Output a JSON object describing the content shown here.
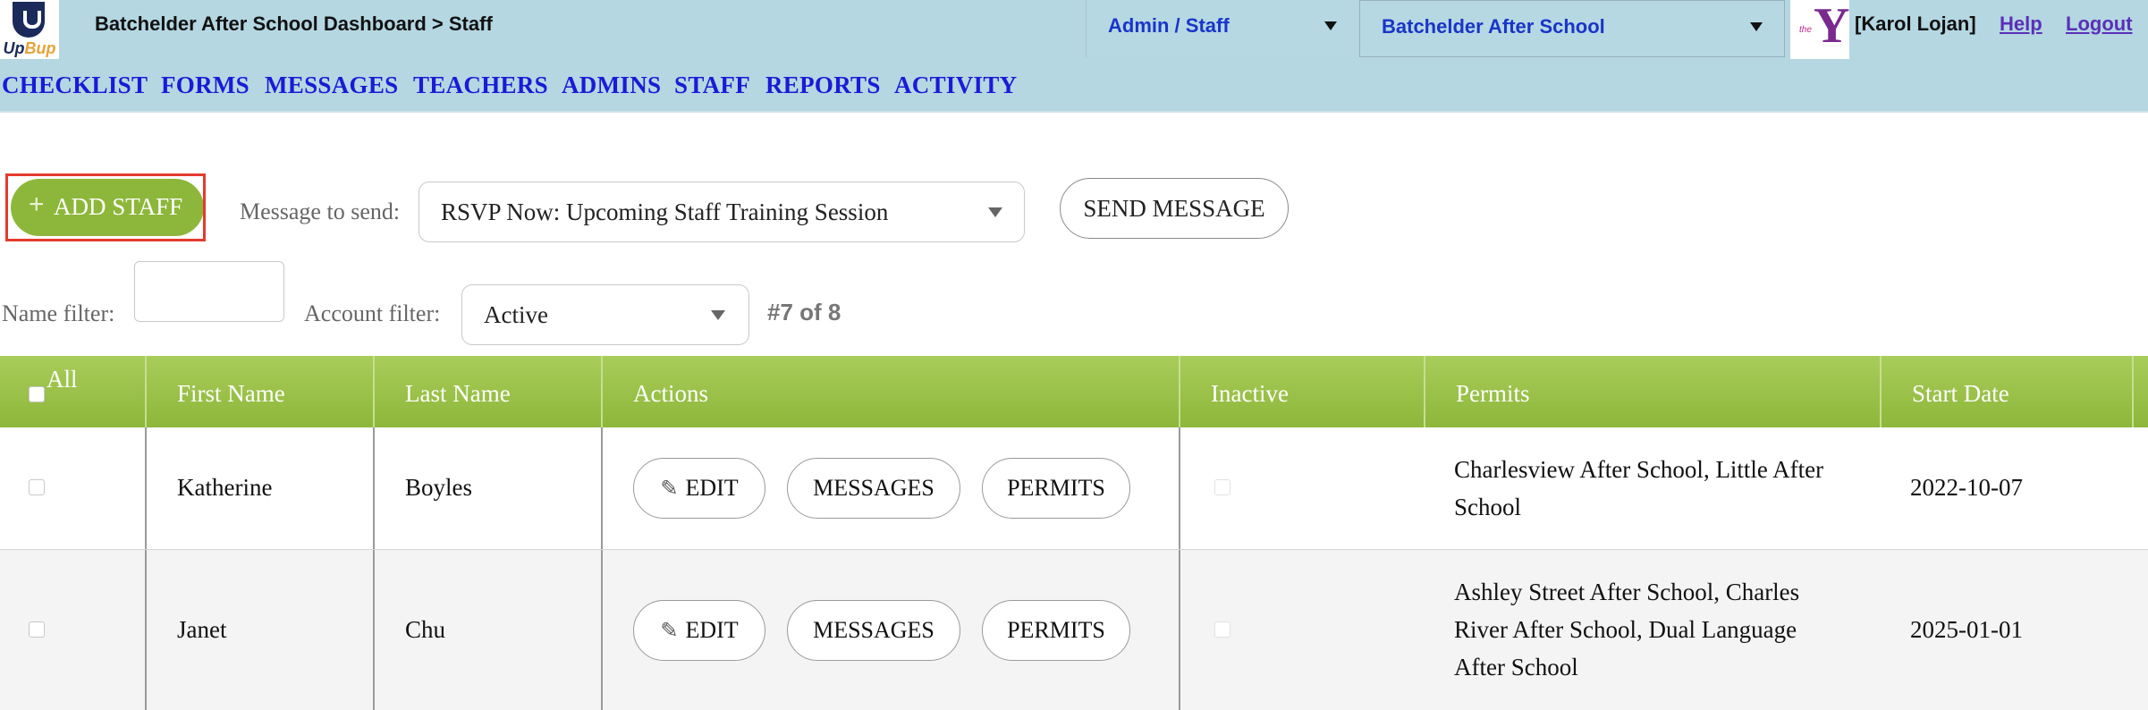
{
  "header": {
    "logo_text_main": "Up",
    "logo_text_accent": "Bup",
    "breadcrumb": "Batchelder After School Dashboard > Staff",
    "role_select": "Admin / Staff",
    "school_select": "Batchelder After School",
    "partner_logo_small": "the",
    "partner_logo_letter": "Y",
    "user": "[Karol Lojan]",
    "help": "Help",
    "logout": "Logout"
  },
  "nav": [
    "CHECKLIST",
    "FORMS",
    "MESSAGES",
    "TEACHERS",
    "ADMINS",
    "STAFF",
    "REPORTS",
    "ACTIVITY"
  ],
  "toolbar": {
    "add_plus": "+",
    "add_staff": "ADD STAFF",
    "message_label": "Message to send:",
    "message_selected": "RSVP Now: Upcoming Staff Training Session",
    "send_message": "SEND MESSAGE"
  },
  "filters": {
    "name_label": "Name filter:",
    "name_value": "",
    "account_label": "Account filter:",
    "account_selected": "Active",
    "counter": "#7 of 8"
  },
  "table": {
    "headers": {
      "all": "All",
      "first_name": "First Name",
      "last_name": "Last Name",
      "actions": "Actions",
      "inactive": "Inactive",
      "permits": "Permits",
      "start_date": "Start Date"
    },
    "action_labels": {
      "edit": "EDIT",
      "messages": "MESSAGES",
      "permits": "PERMITS"
    },
    "rows": [
      {
        "first": "Katherine",
        "last": "Boyles",
        "permits_lines": [
          "Charlesview After School, Little After",
          "School"
        ],
        "start": "2022-10-07"
      },
      {
        "first": "Janet",
        "last": "Chu",
        "permits_lines": [
          "Ashley Street After School, Charles",
          "River After School, Dual Language",
          "After School"
        ],
        "start": "2025-01-01"
      }
    ]
  },
  "colors": {
    "header_bg": "#b4d7e2",
    "nav_link": "#1a1ad6",
    "accent_green": "#8db73a",
    "highlight_red": "#e53a2e",
    "link_purple": "#5a2fb8"
  },
  "icons": {
    "pencil": "✎",
    "dropdown": "chevron-down"
  }
}
